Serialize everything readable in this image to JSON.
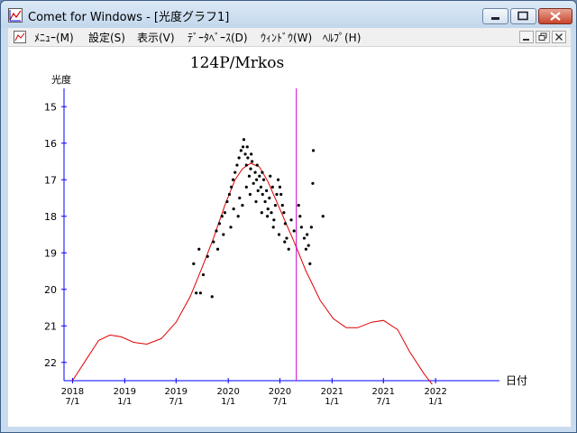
{
  "window": {
    "title": "Comet for Windows - [光度グラフ1]"
  },
  "menu": {
    "items": [
      {
        "label": "ﾒﾆｭｰ(M)"
      },
      {
        "label": "設定(S)"
      },
      {
        "label": "表示(V)"
      },
      {
        "label": "ﾃﾞｰﾀﾍﾞｰｽ(D)"
      },
      {
        "label": "ｳｨﾝﾄﾞｳ(W)"
      },
      {
        "label": "ﾍﾙﾌﾟ(H)"
      }
    ]
  },
  "colors": {
    "axis": "#0000ff",
    "curve": "#e00000",
    "marker": "#cc00cc",
    "points": "#000000"
  },
  "chart_data": {
    "type": "scatter",
    "title": "124P/Mrkos",
    "ylabel": "光度",
    "xlabel": "日付",
    "ylim": [
      22.5,
      14.5
    ],
    "yticks": [
      15,
      16,
      17,
      18,
      19,
      20,
      21,
      22
    ],
    "x_unit": "days",
    "xlim": [
      "2018-06-01",
      "2022-08-30"
    ],
    "xticks": [
      {
        "date": "2018-07-01",
        "year": "2018",
        "md": "7/1"
      },
      {
        "date": "2019-01-01",
        "year": "2019",
        "md": "1/1"
      },
      {
        "date": "2019-07-01",
        "year": "2019",
        "md": "7/1"
      },
      {
        "date": "2020-01-01",
        "year": "2020",
        "md": "1/1"
      },
      {
        "date": "2020-07-01",
        "year": "2020",
        "md": "7/1"
      },
      {
        "date": "2021-01-01",
        "year": "2021",
        "md": "1/1"
      },
      {
        "date": "2021-07-01",
        "year": "2021",
        "md": "7/1"
      },
      {
        "date": "2022-01-01",
        "year": "2022",
        "md": "1/1"
      }
    ],
    "current_date": "2020-08-28",
    "predicted_curve": [
      [
        "2018-07-01",
        22.5
      ],
      [
        "2018-08-20",
        21.9
      ],
      [
        "2018-10-01",
        21.4
      ],
      [
        "2018-11-10",
        21.25
      ],
      [
        "2018-12-20",
        21.3
      ],
      [
        "2019-02-01",
        21.45
      ],
      [
        "2019-03-20",
        21.5
      ],
      [
        "2019-05-10",
        21.35
      ],
      [
        "2019-07-01",
        20.9
      ],
      [
        "2019-08-20",
        20.2
      ],
      [
        "2019-10-01",
        19.4
      ],
      [
        "2019-11-10",
        18.6
      ],
      [
        "2019-12-20",
        17.7
      ],
      [
        "2020-01-25",
        17.0
      ],
      [
        "2020-02-20",
        16.7
      ],
      [
        "2020-03-20",
        16.55
      ],
      [
        "2020-04-20",
        16.65
      ],
      [
        "2020-05-20",
        17.05
      ],
      [
        "2020-07-01",
        17.8
      ],
      [
        "2020-08-20",
        18.7
      ],
      [
        "2020-10-01",
        19.5
      ],
      [
        "2020-11-20",
        20.3
      ],
      [
        "2021-01-05",
        20.8
      ],
      [
        "2021-02-20",
        21.05
      ],
      [
        "2021-04-01",
        21.05
      ],
      [
        "2021-05-20",
        20.9
      ],
      [
        "2021-07-01",
        20.85
      ],
      [
        "2021-08-20",
        21.1
      ],
      [
        "2021-10-01",
        21.7
      ],
      [
        "2021-11-20",
        22.3
      ],
      [
        "2021-12-20",
        22.6
      ]
    ],
    "observations": [
      [
        "2019-09-01",
        19.3
      ],
      [
        "2019-09-20",
        18.9
      ],
      [
        "2019-10-05",
        19.6
      ],
      [
        "2019-09-10",
        20.1
      ],
      [
        "2019-09-25",
        20.1
      ],
      [
        "2019-10-20",
        19.1
      ],
      [
        "2019-11-05",
        20.2
      ],
      [
        "2019-11-10",
        18.7
      ],
      [
        "2019-11-20",
        18.4
      ],
      [
        "2019-12-01",
        18.2
      ],
      [
        "2019-12-10",
        18.0
      ],
      [
        "2019-12-20",
        17.9
      ],
      [
        "2019-12-28",
        17.6
      ],
      [
        "2020-01-05",
        17.4
      ],
      [
        "2020-01-12",
        17.2
      ],
      [
        "2020-01-18",
        17.0
      ],
      [
        "2020-01-25",
        16.8
      ],
      [
        "2020-02-01",
        16.6
      ],
      [
        "2020-02-08",
        16.4
      ],
      [
        "2020-02-15",
        16.2
      ],
      [
        "2020-02-22",
        16.1
      ],
      [
        "2020-02-25",
        15.9
      ],
      [
        "2020-03-01",
        16.3
      ],
      [
        "2020-03-05",
        16.6
      ],
      [
        "2020-03-10",
        16.4
      ],
      [
        "2020-03-15",
        16.9
      ],
      [
        "2020-03-20",
        16.7
      ],
      [
        "2020-03-25",
        16.5
      ],
      [
        "2020-03-30",
        17.1
      ],
      [
        "2020-04-05",
        16.8
      ],
      [
        "2020-04-10",
        17.0
      ],
      [
        "2020-04-15",
        17.3
      ],
      [
        "2020-04-20",
        16.9
      ],
      [
        "2020-04-25",
        17.2
      ],
      [
        "2020-05-01",
        17.4
      ],
      [
        "2020-05-05",
        17.0
      ],
      [
        "2020-05-10",
        17.6
      ],
      [
        "2020-05-15",
        17.3
      ],
      [
        "2020-05-20",
        17.8
      ],
      [
        "2020-05-25",
        17.5
      ],
      [
        "2020-06-01",
        17.9
      ],
      [
        "2020-06-05",
        17.2
      ],
      [
        "2020-06-10",
        18.1
      ],
      [
        "2020-06-15",
        17.7
      ],
      [
        "2020-06-20",
        17.4
      ],
      [
        "2020-06-25",
        17.0
      ],
      [
        "2020-07-01",
        17.2
      ],
      [
        "2020-07-05",
        17.4
      ],
      [
        "2020-07-10",
        17.7
      ],
      [
        "2020-07-15",
        17.9
      ],
      [
        "2020-07-20",
        18.2
      ],
      [
        "2020-07-25",
        18.6
      ],
      [
        "2020-08-01",
        18.9
      ],
      [
        "2020-08-10",
        18.1
      ],
      [
        "2020-08-20",
        18.4
      ],
      [
        "2020-09-05",
        17.7
      ],
      [
        "2020-09-10",
        18.0
      ],
      [
        "2020-09-15",
        18.3
      ],
      [
        "2020-09-25",
        18.6
      ],
      [
        "2020-10-01",
        18.9
      ],
      [
        "2020-10-05",
        18.5
      ],
      [
        "2020-10-10",
        18.8
      ],
      [
        "2020-10-15",
        19.3
      ],
      [
        "2020-10-20",
        18.3
      ],
      [
        "2020-10-25",
        17.1
      ],
      [
        "2020-10-27",
        16.2
      ],
      [
        "2020-11-30",
        18.0
      ],
      [
        "2020-01-20",
        17.8
      ],
      [
        "2020-02-10",
        17.5
      ],
      [
        "2020-03-05",
        17.2
      ],
      [
        "2020-03-18",
        17.4
      ],
      [
        "2020-04-08",
        17.6
      ],
      [
        "2020-04-28",
        17.9
      ],
      [
        "2020-05-18",
        18.0
      ],
      [
        "2020-06-08",
        18.3
      ],
      [
        "2020-06-28",
        18.5
      ],
      [
        "2020-07-18",
        18.7
      ],
      [
        "2019-11-25",
        18.9
      ],
      [
        "2019-12-15",
        18.5
      ],
      [
        "2020-01-10",
        18.3
      ],
      [
        "2020-02-05",
        18.0
      ],
      [
        "2020-02-20",
        17.7
      ],
      [
        "2020-03-08",
        16.1
      ],
      [
        "2020-03-22",
        16.3
      ],
      [
        "2020-04-12",
        16.6
      ],
      [
        "2020-04-30",
        16.8
      ],
      [
        "2020-05-28",
        16.9
      ]
    ]
  }
}
